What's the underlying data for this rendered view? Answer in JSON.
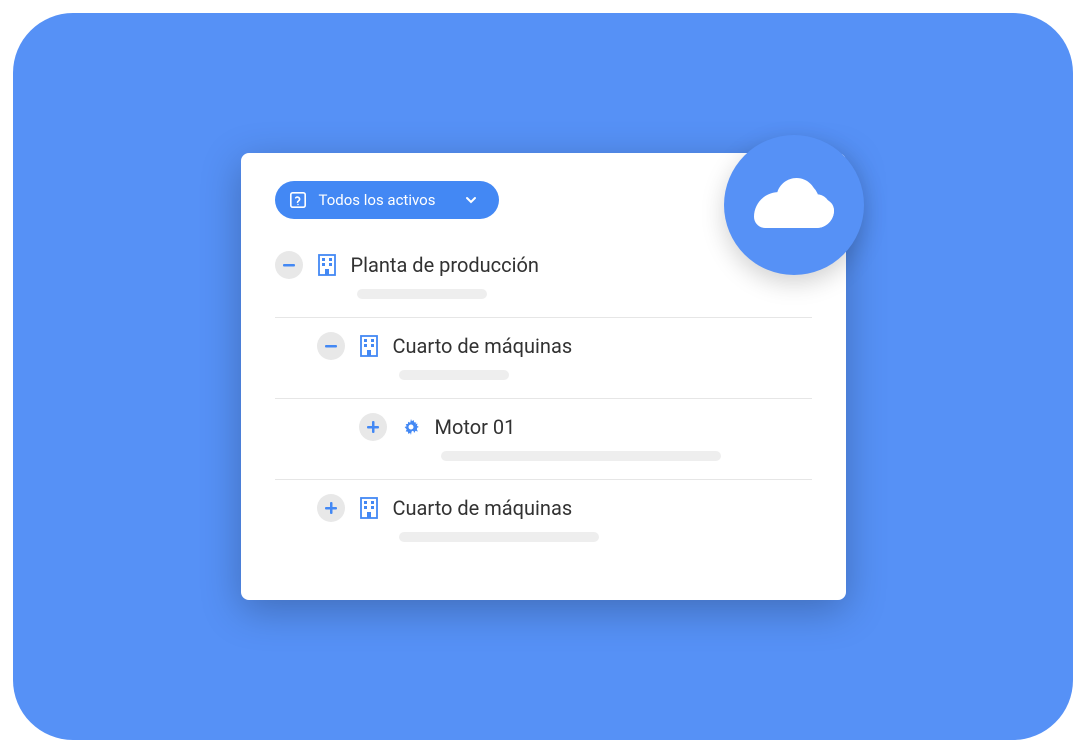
{
  "dropdown": {
    "label": "Todos los activos"
  },
  "tree": {
    "item0": {
      "label": "Planta de producción"
    },
    "item1": {
      "label": "Cuarto de máquinas"
    },
    "item2": {
      "label": "Motor 01"
    },
    "item3": {
      "label": "Cuarto de máquinas"
    }
  },
  "colors": {
    "accent": "#4388f4",
    "bg": "#5691f6"
  }
}
